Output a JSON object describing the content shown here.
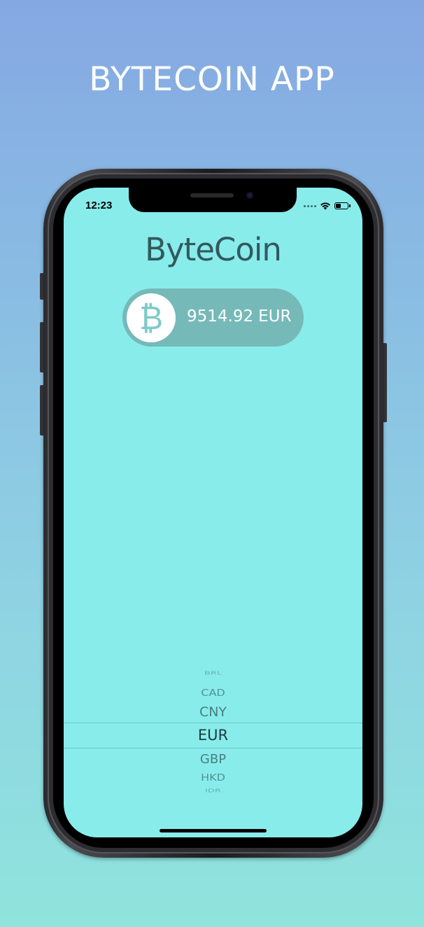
{
  "page": {
    "title": "BYTECOIN APP"
  },
  "status_bar": {
    "time": "12:23",
    "wifi_icon": "wifi-icon",
    "battery_icon": "battery-icon"
  },
  "app": {
    "title": "ByteCoin",
    "coin_icon": "bitcoin-icon",
    "price": "9514.92",
    "currency": "EUR"
  },
  "picker": {
    "items": [
      "BRL",
      "CAD",
      "CNY",
      "EUR",
      "GBP",
      "HKD",
      "IDR"
    ],
    "selected": "EUR"
  },
  "colors": {
    "screen_background": "#88ecea",
    "pill_background": "#76b9b9",
    "accent_coin": "#7ecaca"
  }
}
